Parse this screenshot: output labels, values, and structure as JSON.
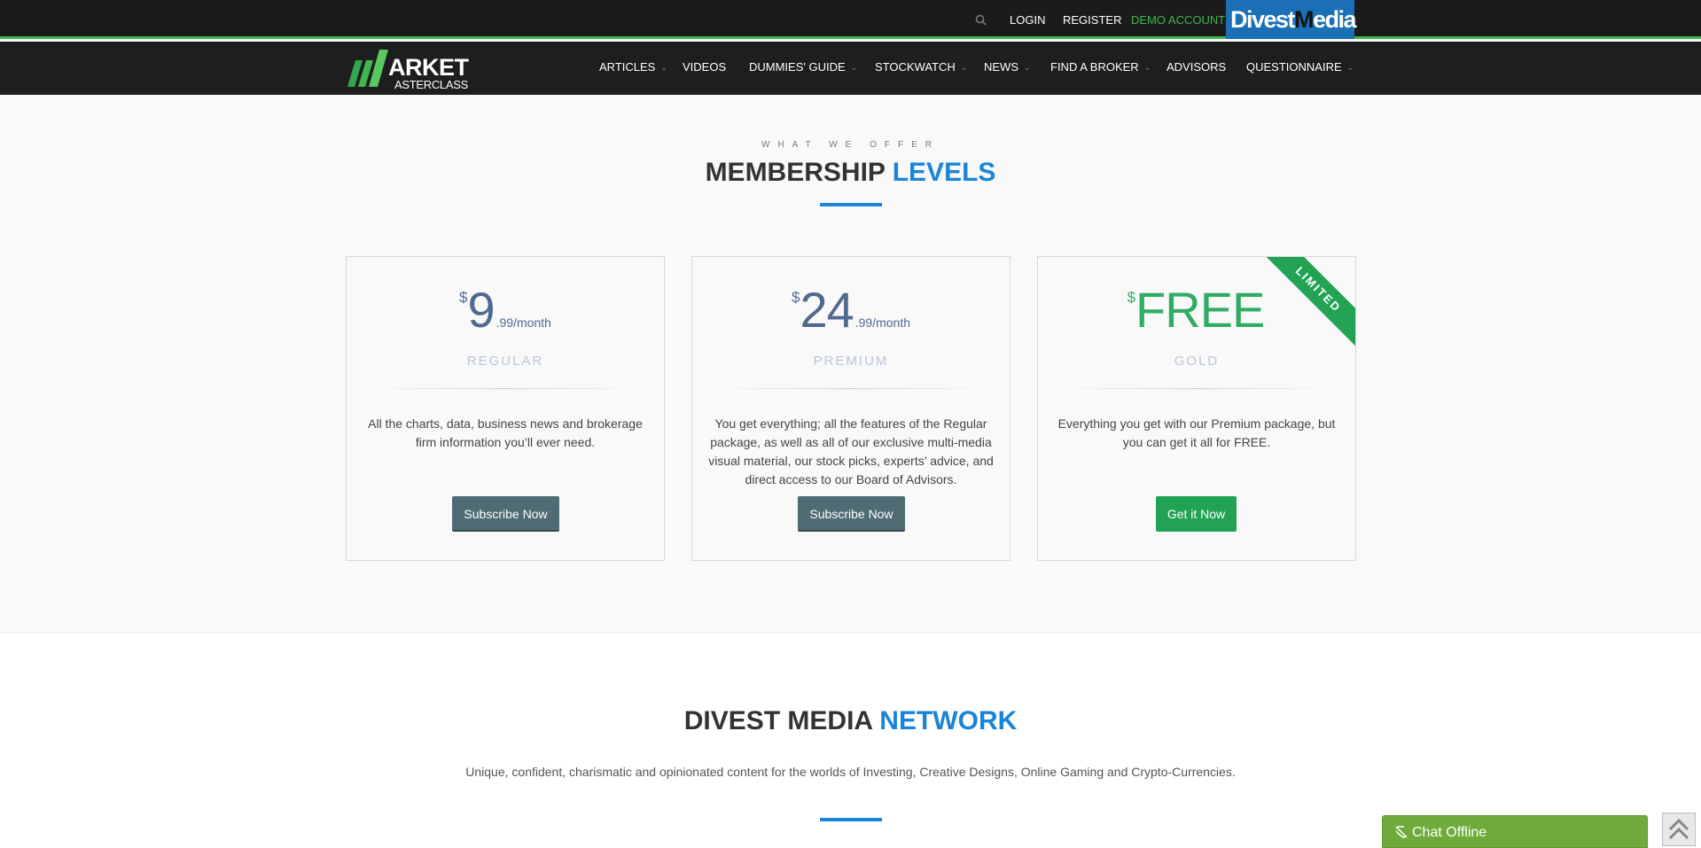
{
  "topbar": {
    "login": "LOGIN",
    "register": "REGISTER",
    "demo": "DEMO ACCOUNT",
    "brand_part1": "Divest",
    "brand_part2": "M",
    "brand_part3": "edia"
  },
  "logo": {
    "line1": "ARKET",
    "line2": "ASTERCLASS"
  },
  "nav": {
    "articles": "ARTICLES",
    "videos": "VIDEOS",
    "dummies": "DUMMIES' GUIDE",
    "stockwatch": "STOCKWATCH",
    "news": "NEWS",
    "broker": "FIND A BROKER",
    "advisors": "ADVISORS",
    "questionnaire": "QUESTIONNAIRE"
  },
  "membership": {
    "eyebrow": "WHAT WE OFFER",
    "title_main": "MEMBERSHIP ",
    "title_accent": "LEVELS",
    "plans": [
      {
        "currency": "$",
        "amount": "9",
        "per": ".99/month",
        "level": "REGULAR",
        "description": "All the charts, data, business news and brokerage firm information you’ll ever need.",
        "button": "Subscribe Now"
      },
      {
        "currency": "$",
        "amount": "24",
        "per": ".99/month",
        "level": "PREMIUM",
        "description": "You get everything; all the features of the Regular package, as well as all of our exclusive multi-media visual material, our stock picks, experts’ advice, and direct access to our Board of Advisors.",
        "button": "Subscribe Now"
      },
      {
        "currency": "$",
        "amount": "FREE",
        "per": "",
        "level": "GOLD",
        "description": "Everything you get with our Premium package, but you can get it all for FREE.",
        "button": "Get it Now",
        "ribbon": "LIMITED"
      }
    ]
  },
  "network": {
    "title_main": "DIVEST MEDIA ",
    "title_accent": "NETWORK",
    "subtext": "Unique, confident, charismatic and opinionated content for the worlds of Investing, Creative Designs, Online Gaming and Crypto-Currencies."
  },
  "chat": {
    "label": "Chat Offline"
  },
  "colors": {
    "accent_blue": "#1a84d8",
    "accent_green": "#3fb64e",
    "button_slate": "#4f6b73",
    "button_green": "#22a354"
  }
}
